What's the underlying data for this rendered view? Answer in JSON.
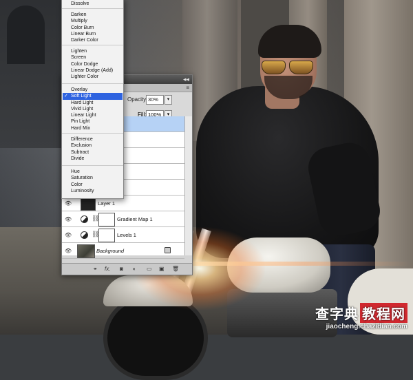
{
  "colors": {
    "selection_blue": "#2e63e0",
    "selected_layer": "#b6d2f5",
    "watermark_red": "#d0282f"
  },
  "blend_menu": {
    "items": [
      "Dissolve",
      "Darken",
      "Multiply",
      "Color Burn",
      "Linear Burn",
      "Darker Color",
      "Lighten",
      "Screen",
      "Color Dodge",
      "Linear Dodge (Add)",
      "Lighter Color",
      "Overlay",
      "Soft Light",
      "Hard Light",
      "Vivid Light",
      "Linear Light",
      "Pin Light",
      "Hard Mix",
      "Difference",
      "Exclusion",
      "Subtract",
      "Divide",
      "Hue",
      "Saturation",
      "Color",
      "Luminosity"
    ],
    "selected": "Soft Light",
    "check": "✓"
  },
  "layers_panel": {
    "collapse_icon": "◂◂",
    "menu_icon": "≡",
    "opacity_label": "Opacity:",
    "opacity_value": "30%",
    "fill_label": "Fill:",
    "fill_value": "100%",
    "dropdown_arrow": "▾",
    "partial_label": "y",
    "layers": [
      {
        "name": "Layer 1",
        "kind": "pixel"
      },
      {
        "name": "Gradient Map 1",
        "kind": "adjustment"
      },
      {
        "name": "Levels 1",
        "kind": "adjustment"
      },
      {
        "name": "Background",
        "kind": "background",
        "locked": true
      }
    ],
    "eye_icon": "👁",
    "chain_icon": "⛓",
    "footer_icons": [
      "link-icon",
      "fx-icon",
      "mask-icon",
      "adjustment-icon",
      "folder-icon",
      "new-layer-icon",
      "trash-icon"
    ],
    "footer_fx": "fx."
  },
  "watermark": {
    "main": "查字典",
    "boxed": "教程网",
    "url": "jiaocheng.chazidian.com"
  }
}
